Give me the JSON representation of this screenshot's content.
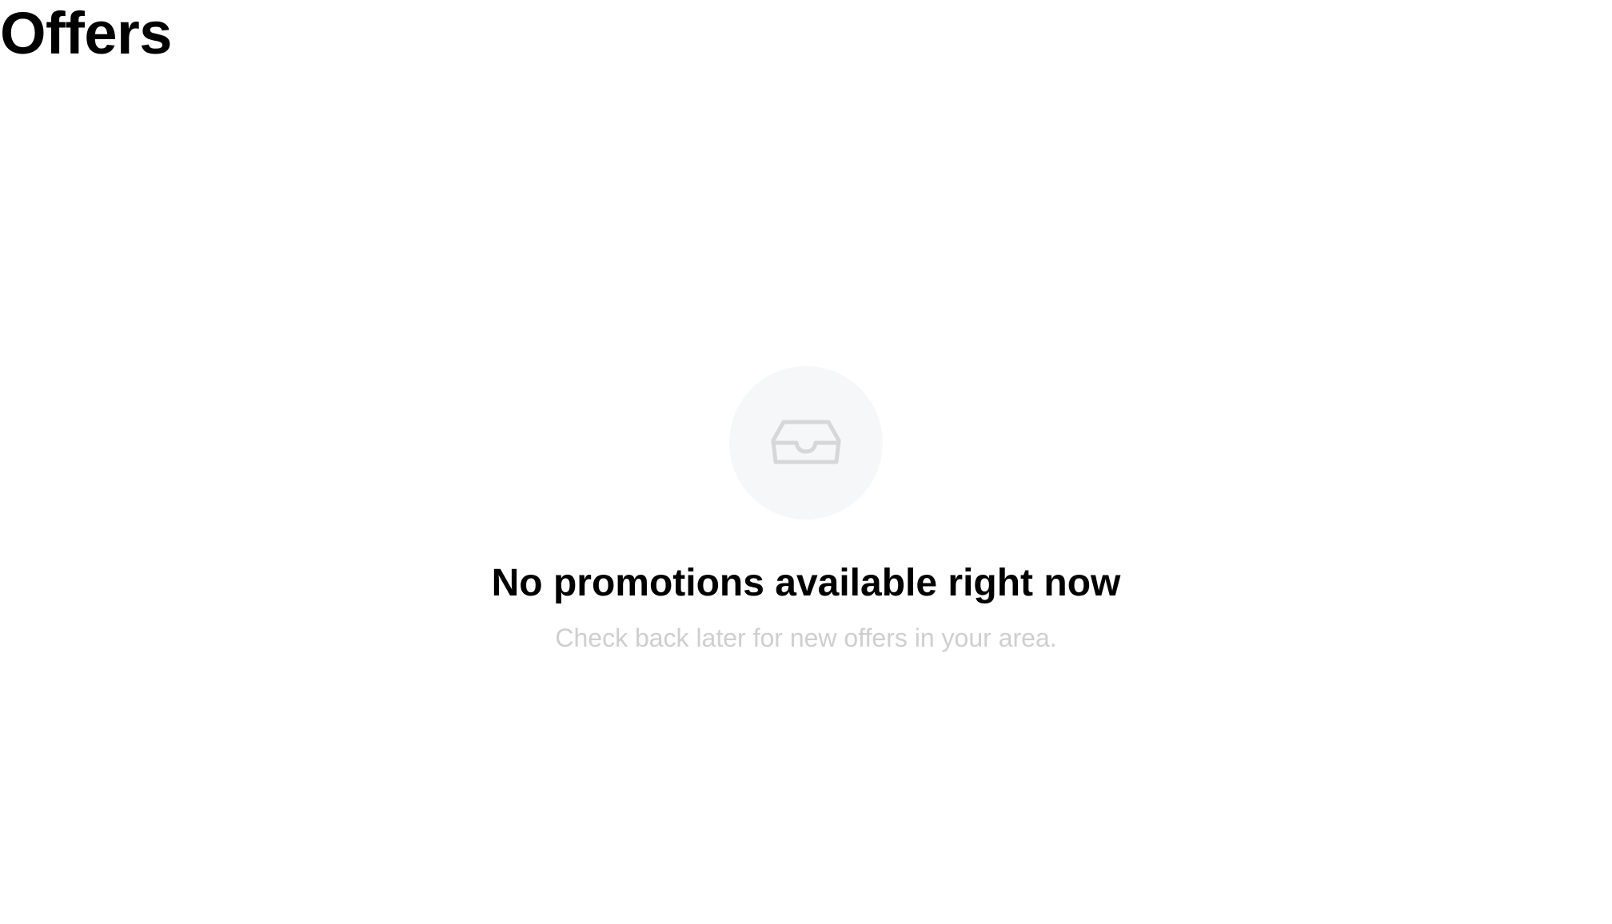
{
  "header": {
    "title": "Offers"
  },
  "empty_state": {
    "icon": "inbox-tray-icon",
    "heading": "No promotions available right now",
    "subtext": "Check back later for new offers in your area."
  },
  "colors": {
    "background": "#ffffff",
    "title": "#000000",
    "subtext": "#cfcfcf",
    "icon_circle": "#f6f7f8",
    "icon_stroke": "#d6d7d9"
  }
}
